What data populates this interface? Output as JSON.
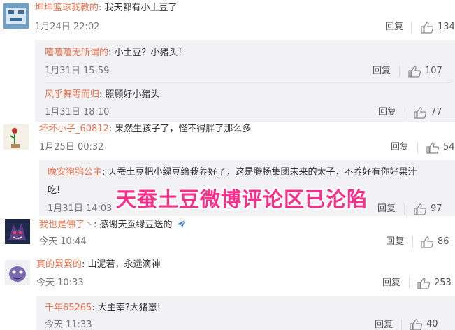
{
  "comments": [
    {
      "user": "坤坤篮球我教的",
      "colon": ":",
      "text": "我天都有小土豆了",
      "time": "1月24日 22:02",
      "reply": "回复",
      "likes": "134",
      "replies": [
        {
          "user": "嘻嘻嘻无所谓的",
          "colon": ":",
          "text": "小土豆？小猪头！",
          "time": "1月31日 15:59",
          "reply": "回复",
          "likes": "107"
        },
        {
          "user": "风乎舞雩而归",
          "colon": ":",
          "text": "照顾好小猪头",
          "time": "1月31日 18:10",
          "reply": "回复",
          "likes": "77"
        }
      ]
    },
    {
      "user": "坏坏小子_60812",
      "colon": ":",
      "text": "果然生孩子了，怪不得胖了那么多",
      "time": "1月25日 00:32",
      "reply": "回复",
      "likes": "54",
      "replies": [
        {
          "user": "晚安狍鸮公主",
          "colon": ":",
          "text": "天蚕土豆把小绿豆给我养好了，这是腾扬集团未来的太子，不养好有你好果汁",
          "text2": "吃!",
          "time": "1月31日 14:03",
          "reply": "回复",
          "likes": "97"
        }
      ]
    },
    {
      "user": "我也是佛了丶",
      "colon": ":",
      "text": "感谢天蚕绿豆送的",
      "time": "今天 10:44",
      "reply": "回复",
      "likes": "86"
    },
    {
      "user": "真的累累的",
      "colon": ":",
      "text": "山泥若，永远滴神",
      "time": "今天 10:33",
      "reply": "回复",
      "likes": "253",
      "replies": [
        {
          "user": "千年65265",
          "colon": ":",
          "text": "大主宰?大猪崽!",
          "time": "今天 11:33",
          "reply": "回复",
          "likes": "40"
        }
      ]
    }
  ],
  "overlay": "天蚕土豆微博评论区已沦陷",
  "icons": {
    "like": "thumbs-up-icon",
    "gift": "airplane-icon"
  },
  "colors": {
    "username": "#eb7350",
    "overlay": "#ff2d8a",
    "reply_bg": "#f2f2f5"
  }
}
